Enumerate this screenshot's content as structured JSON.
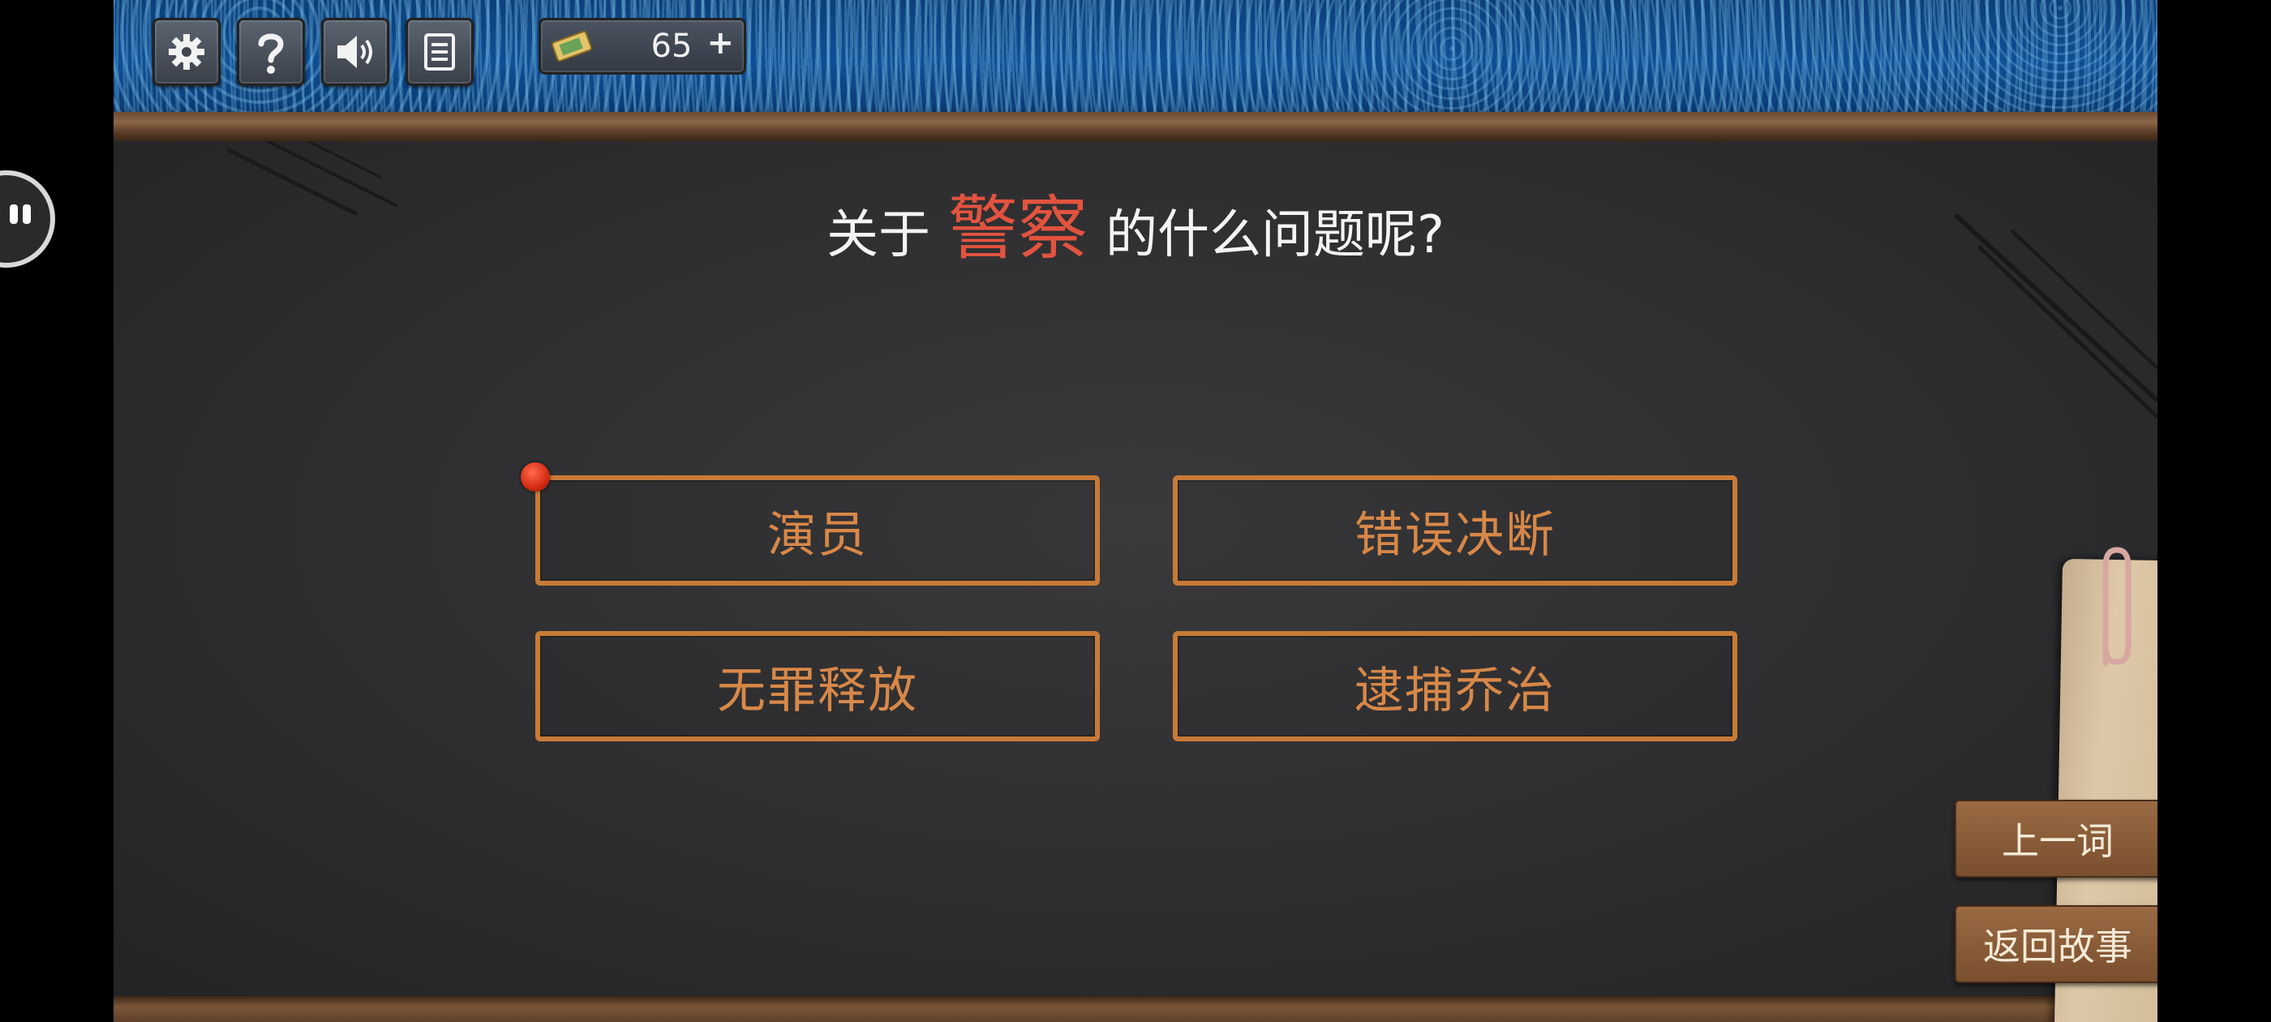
{
  "toolbar": {
    "settings_icon": "gear-icon",
    "help_icon": "question-icon",
    "sound_icon": "speaker-icon",
    "log_icon": "notebook-icon"
  },
  "currency": {
    "icon": "ticket-icon",
    "value": "65",
    "plus": "+"
  },
  "question": {
    "prefix": "关于",
    "keyword": "警察",
    "suffix": "的什么问题呢?"
  },
  "options": [
    {
      "label": "演员",
      "selected": true
    },
    {
      "label": "错误决断"
    },
    {
      "label": "无罪释放"
    },
    {
      "label": "逮捕乔治"
    }
  ],
  "side": {
    "prev_word": "上一词",
    "back_story": "返回故事"
  },
  "colors": {
    "keyword": "#e2533f",
    "option_border": "#c97a37",
    "option_text": "#d88848",
    "board": "#2e2e30",
    "banner": "#0f4f95"
  }
}
